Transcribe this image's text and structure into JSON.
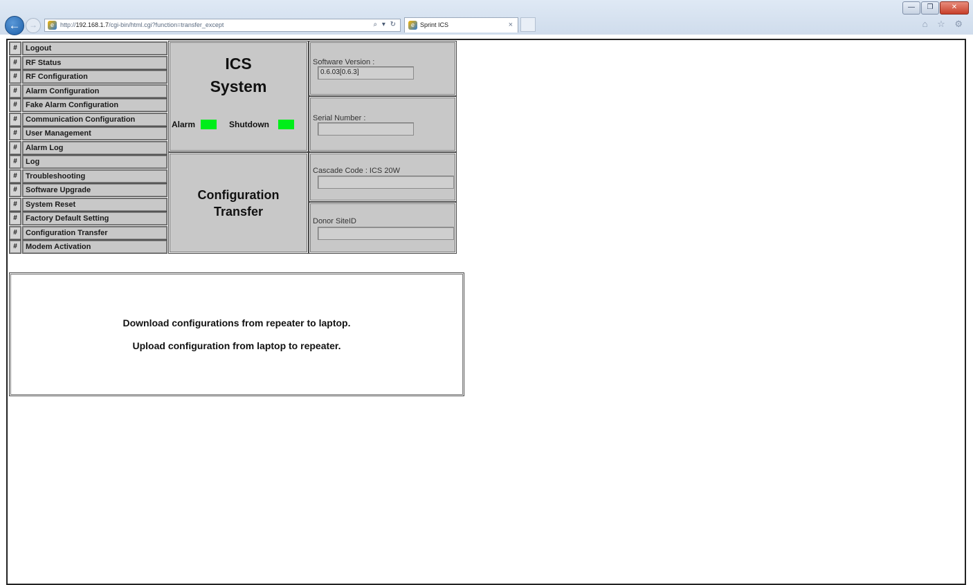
{
  "browser": {
    "url_prefix": "http://",
    "url_host": "192.168.1.7",
    "url_path": "/cgi-bin/html.cgi?function=transfer_except",
    "tab_title": "Sprint ICS",
    "address_buttons": "⌕ ▾ ↻",
    "tools": "⌂ ☆ ⚙",
    "window_min": "—",
    "window_max": "❐",
    "window_close": "✕"
  },
  "menu": {
    "hash": "#",
    "items": [
      "Logout",
      "RF Status",
      "RF Configuration",
      "Alarm Configuration",
      "Fake Alarm Configuration",
      "Communication Configuration",
      "User Management",
      "Alarm Log",
      "Log",
      "Troubleshooting",
      "Software Upgrade",
      "System Reset",
      "Factory Default Setting",
      "Configuration Transfer",
      "Modem Activation"
    ]
  },
  "header": {
    "system_title_line1": "ICS",
    "system_title_line2": "System",
    "alarm_label": "Alarm",
    "shutdown_label": "Shutdown",
    "page_title_line1": "Configuration",
    "page_title_line2": "Transfer",
    "led_color": "#00ee1a"
  },
  "info": {
    "software_version_label": "Software Version :",
    "software_version_value": "0.6.03[0.6.3]",
    "serial_number_label": "Serial Number :",
    "serial_number_value": "",
    "cascade_code_label": "Cascade Code : ICS 20W",
    "cascade_code_value": "",
    "donor_siteid_label": "Donor SiteID",
    "donor_siteid_value": ""
  },
  "content": {
    "download_text": "Download configurations from repeater to laptop.",
    "upload_text": "Upload configuration from laptop to repeater."
  }
}
